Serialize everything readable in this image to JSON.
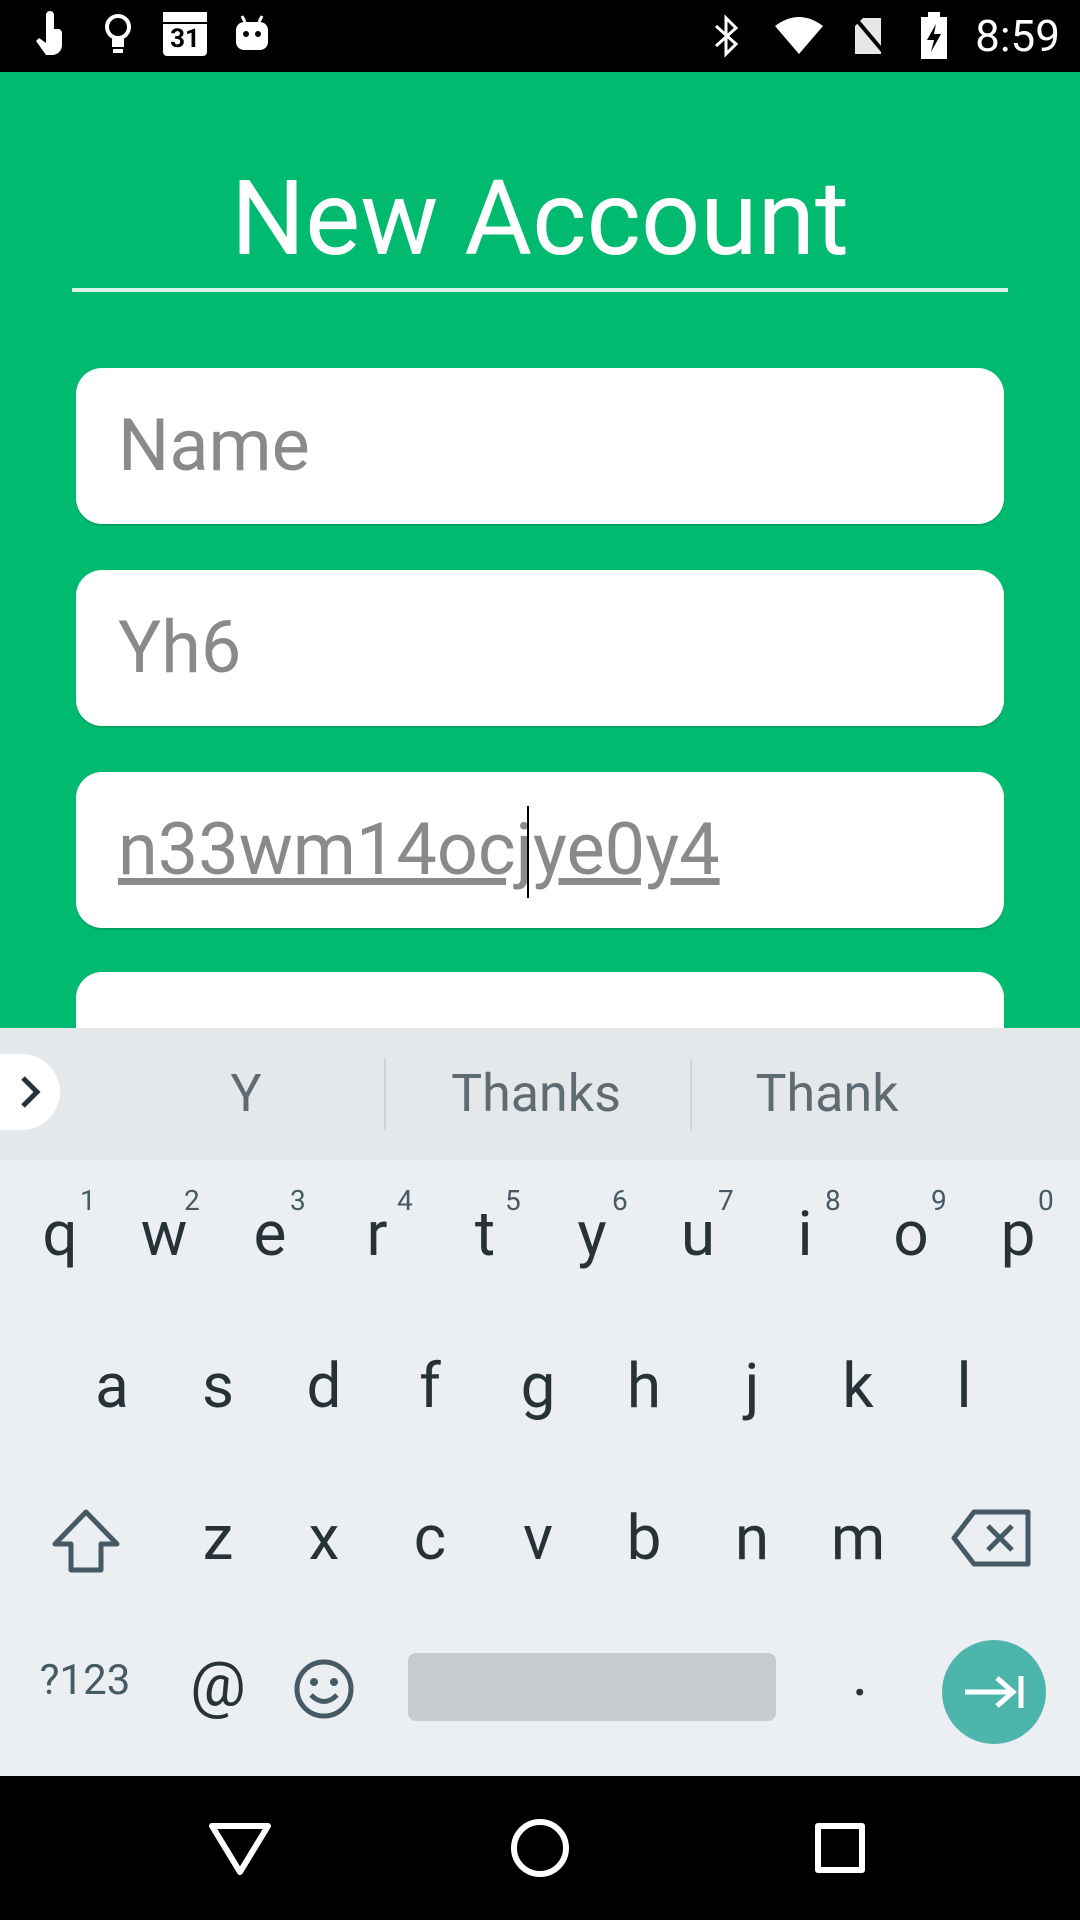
{
  "status_bar": {
    "time": "8:59",
    "left_icons": [
      "touch-icon",
      "lightbulb-icon",
      "calendar-icon",
      "android-icon"
    ],
    "calendar_day": "31",
    "right_icons": [
      "bluetooth-icon",
      "wifi-icon",
      "no-sim-icon",
      "battery-charging-icon"
    ]
  },
  "app": {
    "title": "New Account",
    "fields": {
      "name_placeholder": "Name",
      "second_value": "Yh6",
      "third_value": "n33wm14ocjye0y4"
    },
    "colors": {
      "background": "#00BA6F",
      "field_bg": "#FFFFFF"
    }
  },
  "keyboard": {
    "suggestions": [
      "Y",
      "Thanks",
      "Thank"
    ],
    "row1": [
      {
        "key": "q",
        "hint": "1"
      },
      {
        "key": "w",
        "hint": "2"
      },
      {
        "key": "e",
        "hint": "3"
      },
      {
        "key": "r",
        "hint": "4"
      },
      {
        "key": "t",
        "hint": "5"
      },
      {
        "key": "y",
        "hint": "6"
      },
      {
        "key": "u",
        "hint": "7"
      },
      {
        "key": "i",
        "hint": "8"
      },
      {
        "key": "o",
        "hint": "9"
      },
      {
        "key": "p",
        "hint": "0"
      }
    ],
    "row2": [
      "a",
      "s",
      "d",
      "f",
      "g",
      "h",
      "j",
      "k",
      "l"
    ],
    "row3": [
      "z",
      "x",
      "c",
      "v",
      "b",
      "n",
      "m"
    ],
    "symbols_label": "?123",
    "at_label": "@",
    "period_label": ".",
    "accent": "#4DB6AC"
  },
  "nav_bar": {
    "icons": [
      "back-icon",
      "home-icon",
      "recents-icon"
    ]
  }
}
